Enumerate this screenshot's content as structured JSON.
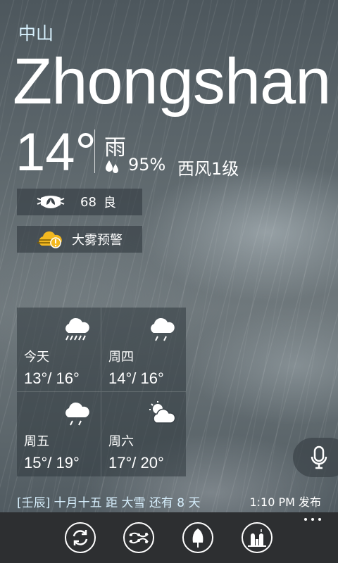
{
  "city": {
    "name_cn": "中山",
    "name_en": "Zhongshan"
  },
  "current": {
    "temperature": "14°",
    "condition": "雨",
    "humidity": "95%",
    "wind": "西风1级"
  },
  "badges": {
    "aqi": {
      "value": "68",
      "label": "良",
      "icon": "mask-icon"
    },
    "warning": {
      "label": "大雾预警",
      "icon": "fog-warning-icon",
      "color": "#f3b820"
    }
  },
  "forecast": [
    {
      "day": "今天",
      "range": "13°/ 16°",
      "icon": "heavy-rain-icon"
    },
    {
      "day": "周四",
      "range": "14°/ 16°",
      "icon": "rain-icon"
    },
    {
      "day": "周五",
      "range": "15°/ 19°",
      "icon": "rain-icon"
    },
    {
      "day": "周六",
      "range": "17°/ 20°",
      "icon": "partly-cloudy-icon"
    }
  ],
  "footer": {
    "almanac": "[壬辰] 十月十五  距 大雪 还有 8 天",
    "published": "1:10 PM 发布"
  },
  "appbar": {
    "buttons": [
      "refresh-icon",
      "trend-icon",
      "umbrella-icon",
      "city-icon"
    ],
    "more": "more-icon"
  }
}
